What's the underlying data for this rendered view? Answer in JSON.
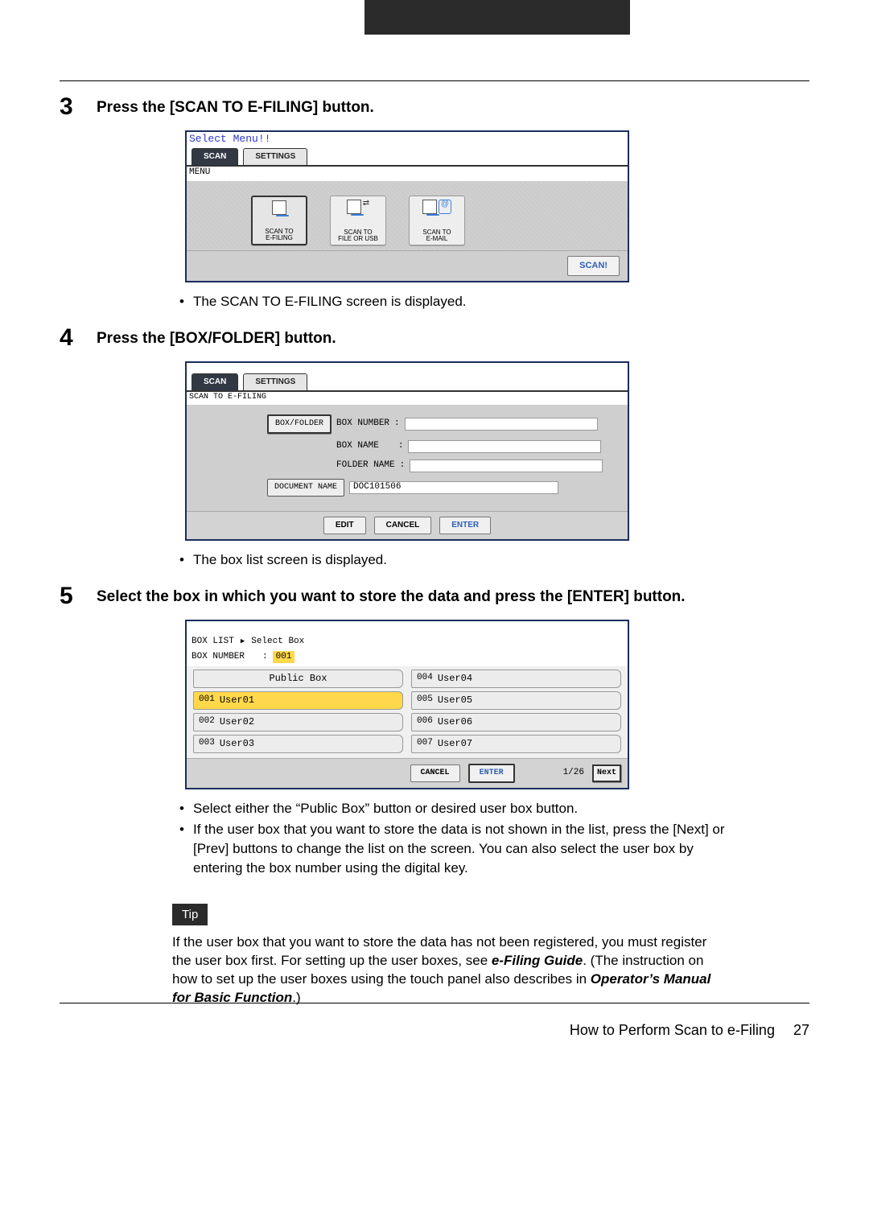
{
  "header_black": "",
  "step3": {
    "num": "3",
    "title": "Press the [SCAN TO E-FILING] button.",
    "bullet1": "The SCAN TO E-FILING screen is displayed."
  },
  "step4": {
    "num": "4",
    "title": "Press the [BOX/FOLDER] button.",
    "bullet1": "The box list screen is displayed."
  },
  "step5": {
    "num": "5",
    "title": "Select the box in which you want to store the data and press the [ENTER] button.",
    "bullet1": "Select either the “Public Box” button or desired user box button.",
    "bullet2": "If the user box that you want to store the data is not shown in the list, press the [Next] or [Prev] buttons to change the list on the screen.  You can also select the user box by entering the box number using the digital key."
  },
  "tip": {
    "badge": "Tip",
    "body_start": "If the user box that you want to store the data has not been registered, you must register the user box first.  For setting up the user boxes, see ",
    "em1": "e-Filing Guide",
    "body_mid": ".  (The instruction on how to set up the user boxes using the touch panel also describes in ",
    "em2": "Operator’s Manual for Basic Function",
    "body_end": ".)"
  },
  "footer": {
    "text": "How to Perform Scan to e-Filing",
    "page": "27"
  },
  "screen1": {
    "title": "Select Menu!!",
    "tab_active": "SCAN",
    "tab_inactive": "SETTINGS",
    "menu_line": "MENU",
    "btn1_l1": "SCAN TO",
    "btn1_l2": "E-FILING",
    "btn2_l1": "SCAN TO",
    "btn2_l2": "FILE OR USB",
    "btn3_l1": "SCAN TO",
    "btn3_l2": "E-MAIL",
    "at": "@",
    "action": "SCAN!"
  },
  "screen2": {
    "tab_active": "SCAN",
    "tab_inactive": "SETTINGS",
    "sub": "SCAN TO E-FILING",
    "box_folder_btn": "BOX/FOLDER",
    "box_number_lbl": "BOX NUMBER",
    "box_name_lbl": "BOX NAME",
    "folder_name_lbl": "FOLDER NAME",
    "doc_name_btn": "DOCUMENT NAME",
    "doc_name_val": "DOC101506",
    "colon": ":",
    "edit": "EDIT",
    "cancel": "CANCEL",
    "enter": "ENTER"
  },
  "screen3": {
    "bc1": "BOX LIST",
    "bc2": "Select Box",
    "boxnum_lbl": "BOX NUMBER",
    "colon": ":",
    "boxnum_val": "001",
    "left": [
      {
        "idx": "",
        "label": "Public Box",
        "public": true
      },
      {
        "idx": "001",
        "label": "User01",
        "selected": true
      },
      {
        "idx": "002",
        "label": "User02"
      },
      {
        "idx": "003",
        "label": "User03"
      }
    ],
    "right": [
      {
        "idx": "004",
        "label": "User04"
      },
      {
        "idx": "005",
        "label": "User05"
      },
      {
        "idx": "006",
        "label": "User06"
      },
      {
        "idx": "007",
        "label": "User07"
      }
    ],
    "cancel": "CANCEL",
    "enter": "ENTER",
    "page_indicator": "1/26",
    "next": "Next"
  }
}
